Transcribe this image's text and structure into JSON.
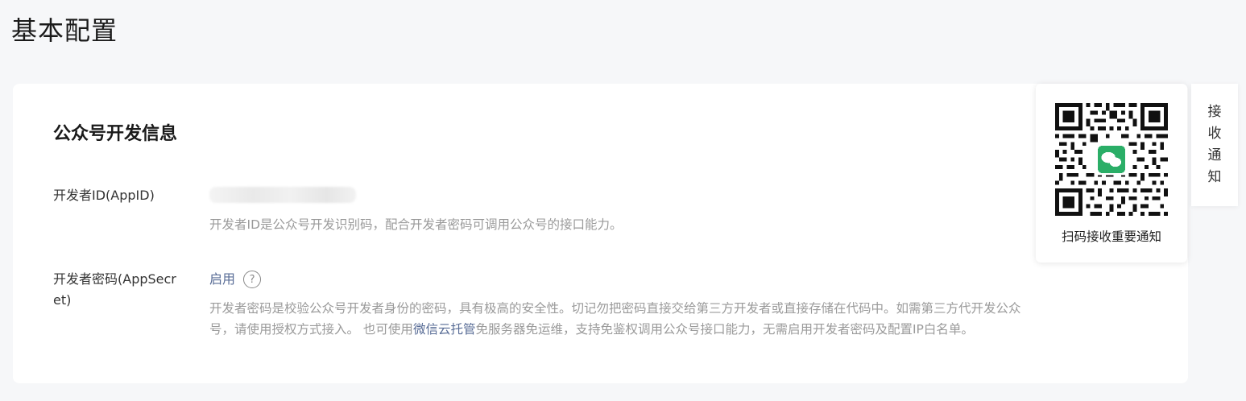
{
  "page": {
    "title": "基本配置"
  },
  "dev_info": {
    "section_title": "公众号开发信息",
    "app_id": {
      "label": "开发者ID(AppID)",
      "description": "开发者ID是公众号开发识别码，配合开发者密码可调用公众号的接口能力。"
    },
    "app_secret": {
      "label": "开发者密码(AppSecret)",
      "status": "启用",
      "help_icon": "question-circle-icon",
      "description_line1": "开发者密码是校验公众号开发者身份的密码，具有极高的安全性。切记勿把密码直接交给第三方开发者或直接存储在代码中。如需第三方代开发公众",
      "description_line2_before": "号，请使用授权方式接入。 也可使用",
      "description_link": "微信云托管",
      "description_line2_after": "免服务器免运维，支持免鉴权调用公众号接口能力，无需启用开发者密码及配置IP白名单。"
    }
  },
  "qr_popup": {
    "label": "扫码接收重要通知",
    "center_icon": "wechat-logo-icon",
    "center_color": "#2aae67"
  },
  "notify_tab": {
    "chars": [
      "接",
      "收",
      "通",
      "知"
    ]
  },
  "colors": {
    "link": "#576b95",
    "muted": "#9a9a9a",
    "background": "#f6f7f9"
  }
}
